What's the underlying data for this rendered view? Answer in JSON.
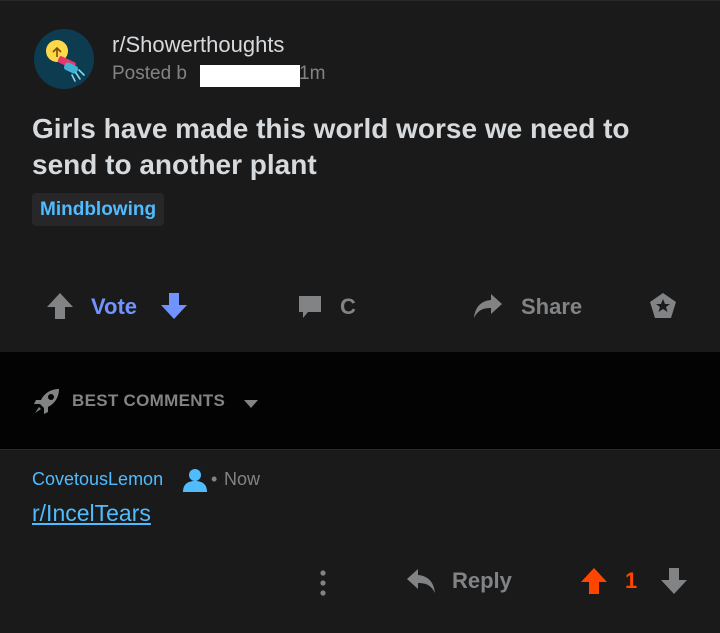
{
  "post": {
    "subreddit": "r/Showerthoughts",
    "posted_by_prefix": "Posted b",
    "posted_by_suffix": "1m",
    "title": "Girls have made this world worse we need to send to another plant",
    "flair": "Mindblowing"
  },
  "actions": {
    "vote_label": "Vote",
    "comment_label": "C",
    "share_label": "Share"
  },
  "sort": {
    "label": "BEST COMMENTS"
  },
  "comment": {
    "author": "CovetousLemon",
    "separator": "•",
    "time": "Now",
    "body": "r/IncelTears",
    "reply_label": "Reply",
    "score": "1"
  },
  "colors": {
    "background": "#1a1a1b",
    "sort_bar": "#030303",
    "link": "#4fbcff",
    "vote_blue": "#7193ff",
    "upvote_orange": "#ff4500",
    "muted": "#818384"
  },
  "icons": {
    "avatar": "showerthoughts-lightbulb-icon",
    "upvote": "arrow-up-icon",
    "downvote": "arrow-down-icon",
    "comment": "speech-bubble-icon",
    "share": "share-arrow-icon",
    "award": "award-icon",
    "sort": "rocket-icon",
    "caret": "caret-down-icon",
    "user": "person-icon",
    "more": "more-vertical-icon",
    "reply": "reply-arrow-icon"
  }
}
